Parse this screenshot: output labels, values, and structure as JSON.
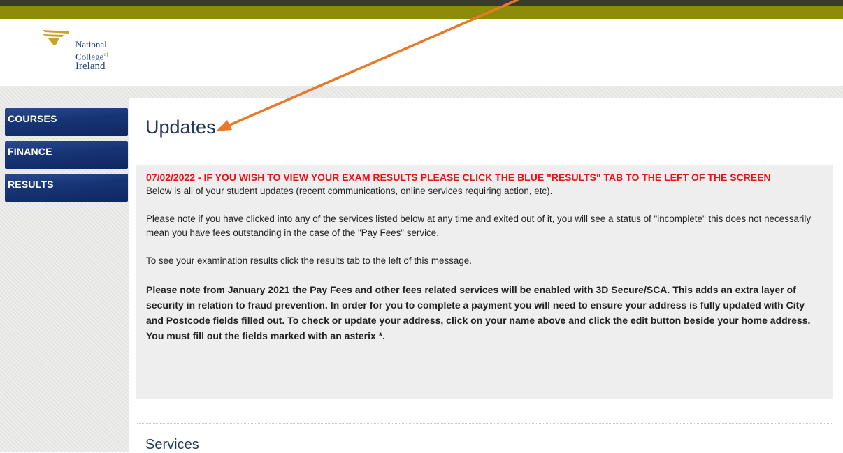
{
  "brand": {
    "name_line1": "National",
    "name_line2": "College",
    "name_line2_suffix": "of",
    "name_line3": "Ireland",
    "olive_color": "#8d8c0a",
    "navy_color": "#1b3f6e"
  },
  "sidebar": {
    "items": [
      {
        "label": "COURSES"
      },
      {
        "label": "FINANCE"
      },
      {
        "label": "RESULTS"
      }
    ]
  },
  "main": {
    "title": "Updates",
    "alert": "07/02/2022 - IF YOU WISH TO VIEW YOUR EXAM RESULTS PLEASE CLICK THE BLUE \"RESULTS\" TAB TO THE LEFT OF THE SCREEN",
    "paragraphs": [
      "Below is all of your student updates (recent communications, online services requiring action, etc).",
      "Please note if you have clicked into any of the services listed below at any time and exited out of it, you will see a status of \"incomplete\" this does not necessarily mean you have fees outstanding in the case of the \"Pay Fees\" service.",
      "To see your examination results click the results tab to the left of this message.",
      "Please note from January 2021 the Pay Fees and other fees related services will be enabled with 3D Secure/SCA. This adds an extra layer of security in relation to fraud prevention. In order for you to complete a payment you will need to ensure your address is fully updated with City and Postcode fields filled out. To check or update your address, click on your name above and click the edit button beside your home address. You must fill out the fields marked with an asterix *."
    ],
    "services_heading": "Services"
  },
  "annotation": {
    "icon": "arrow-icon",
    "color": "#e8782a"
  }
}
